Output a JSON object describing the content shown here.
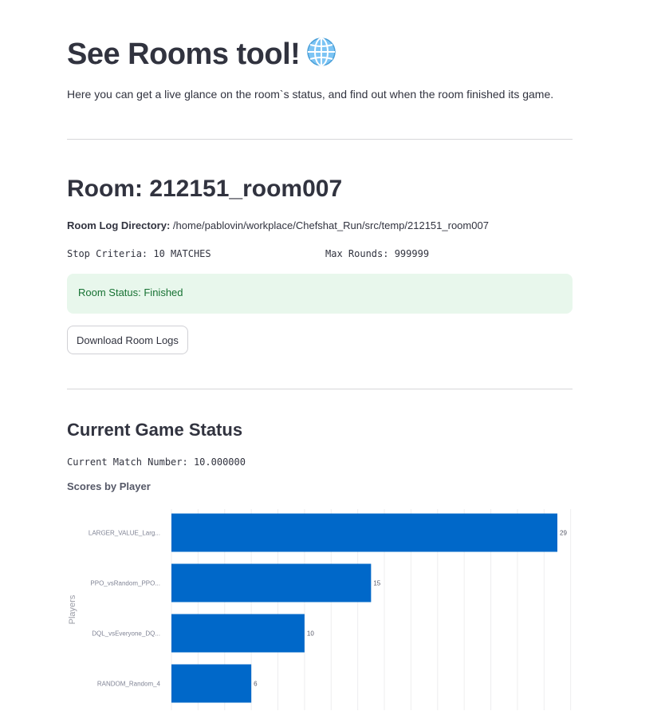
{
  "header": {
    "title": "See Rooms tool!",
    "title_icon": "globe-icon",
    "intro": "Here you can get a live glance on the room`s status, and find out when the room finished its game."
  },
  "room": {
    "heading": "Room: 212151_room007",
    "log_dir_label": "Room Log Directory:",
    "log_dir_value": "/home/pablovin/workplace/Chefshat_Run/src/temp/212151_room007",
    "stop_criteria": "Stop Criteria: 10 MATCHES",
    "max_rounds": "Max Rounds: 999999",
    "status": "Room Status: Finished",
    "download_label": "Download Room Logs"
  },
  "game": {
    "heading": "Current Game Status",
    "match_number": "Current Match Number: 10.000000",
    "chart_title": "Scores by Player"
  },
  "colors": {
    "bar": "#0068c9",
    "status_bg": "#e8f7ec",
    "status_text": "#177233"
  },
  "chart_data": {
    "type": "bar",
    "orientation": "horizontal",
    "title": "Scores by Player",
    "ylabel": "Players",
    "xlabel": "",
    "categories": [
      "LARGER_VALUE_Larg...",
      "PPO_vsRandom_PPO...",
      "DQL_vsEveryone_DQ...",
      "RANDOM_Random_4"
    ],
    "values": [
      29,
      15,
      10,
      6
    ],
    "xlim": [
      0,
      30
    ],
    "grid": true
  }
}
